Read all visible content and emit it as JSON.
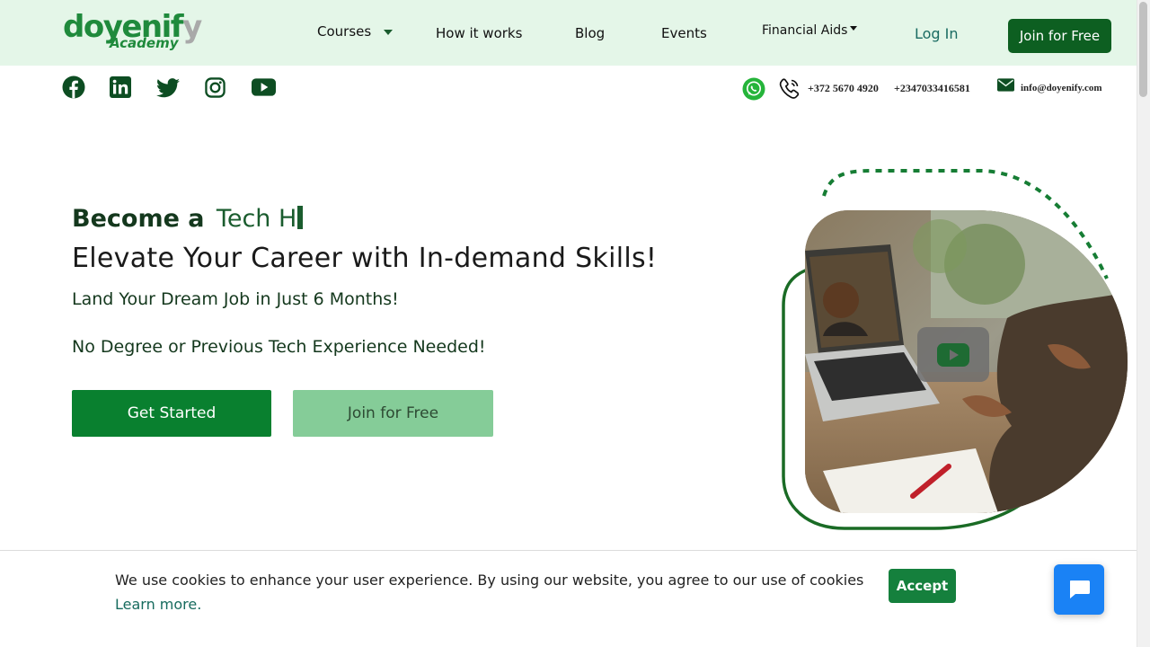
{
  "brand": {
    "logo_main": "doyenif",
    "logo_y": "y",
    "logo_sub": "Academy"
  },
  "nav": {
    "courses": "Courses",
    "how_it_works": "How it works",
    "blog": "Blog",
    "events": "Events",
    "financial_aids": "Financial Aids",
    "login": "Log In",
    "join": "Join for Free"
  },
  "social": [
    "facebook-icon",
    "linkedin-icon",
    "twitter-icon",
    "instagram-icon",
    "youtube-icon"
  ],
  "contact": {
    "phone1": "+372 5670 4920",
    "phone2": "+2347033416581",
    "email": "info@doyenify.com"
  },
  "hero": {
    "prefix": "Become a",
    "typed": "Tech H",
    "title": "Elevate Your Career with In-demand Skills!",
    "sub1": "Land Your Dream Job in Just 6 Months!",
    "sub2": "No Degree or Previous Tech Experience Needed!",
    "btn_primary": "Get Started",
    "btn_secondary": "Join for Free"
  },
  "cookie": {
    "text": "We use cookies to enhance your user experience. By using our website, you agree to our use of cookies ",
    "link": "Learn more.",
    "accept": "Accept"
  },
  "colors": {
    "brand_green": "#0d5f21",
    "nav_bg": "#e4f6e8",
    "primary_btn": "#09802f",
    "secondary_btn": "#85cc98",
    "chat_blue": "#1a82f5"
  }
}
